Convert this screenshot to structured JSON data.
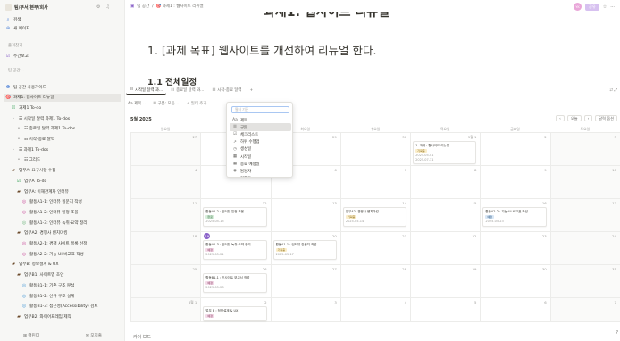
{
  "sidebar": {
    "workspace": "팀/부서/본부/회사",
    "top_items": [
      {
        "icon": "search-icon",
        "glyph": "⌕",
        "label": "검색"
      },
      {
        "icon": "plus-circle-icon",
        "glyph": "⊕",
        "label": "새 페이지"
      }
    ],
    "section_favorites": "즐겨찾기",
    "favorites": [
      {
        "icon": "checkbox-icon",
        "glyph": "☑",
        "label": "주간보고"
      }
    ],
    "section_teamspace": "팀 공간 ⌄",
    "tree": [
      {
        "glyph": "❶",
        "label": "팀 공간 사용가이드",
        "indent": 0,
        "sel": false,
        "color": "#4a7fd6"
      },
      {
        "glyph": "🎯",
        "label": "과제1: 웹사이트 리뉴얼",
        "indent": 0,
        "sel": true,
        "color": "#e0873a"
      },
      {
        "glyph": "☑",
        "label": "과제1 To-do",
        "indent": 1,
        "sel": false,
        "color": "#3aa35a"
      },
      {
        "glyph": "›",
        "label": "☷ 시작일 달력 과제1 To-dos",
        "indent": 1,
        "sel": false,
        "color": "#9b9a97"
      },
      {
        "glyph": "•",
        "label": "☷ 종료일 달력 과제1 To-dos",
        "indent": 2,
        "sel": false,
        "color": "#9b9a97"
      },
      {
        "glyph": "•",
        "label": "☷ 시작-종료 달력",
        "indent": 2,
        "sel": false,
        "color": "#9b9a97"
      },
      {
        "glyph": "›",
        "label": "☷ 과제1 To-dos",
        "indent": 1,
        "sel": false,
        "color": "#9b9a97"
      },
      {
        "glyph": "•",
        "label": "☷ 그리드",
        "indent": 2,
        "sel": false,
        "color": "#9b9a97"
      },
      {
        "glyph": "▰",
        "label": "업무A: 요구사항 수집",
        "indent": 1,
        "sel": false,
        "color": "#6b4a2b"
      },
      {
        "glyph": "☑",
        "label": "업무A To-do",
        "indent": 2,
        "sel": false,
        "color": "#3aa35a"
      },
      {
        "glyph": "▰",
        "label": "업무A: 이해관계자 인터뷰",
        "indent": 2,
        "sel": false,
        "color": "#6b4a2b"
      },
      {
        "glyph": "◎",
        "label": "활동A1-1: 인터뷰 질문지 작성",
        "indent": 3,
        "sel": false,
        "color": "#c94a9a"
      },
      {
        "glyph": "◎",
        "label": "활동A1-2: 인터뷰 일정 조율",
        "indent": 3,
        "sel": false,
        "color": "#c94a9a"
      },
      {
        "glyph": "◎",
        "label": "활동A1-3: 인터뷰 녹취·요약 정리",
        "indent": 3,
        "sel": false,
        "color": "#6bb37a"
      },
      {
        "glyph": "▰",
        "label": "업무A2: 경쟁사 벤치마킹",
        "indent": 2,
        "sel": false,
        "color": "#6b4a2b"
      },
      {
        "glyph": "◎",
        "label": "활동A2-1: 경쟁 사이트 목록 선정",
        "indent": 3,
        "sel": false,
        "color": "#c94a9a"
      },
      {
        "glyph": "◎",
        "label": "활동A2-2: 기능·UI 비교표 작성",
        "indent": 3,
        "sel": false,
        "color": "#c94a9a"
      },
      {
        "glyph": "▰",
        "label": "업무B: 정보설계 & UX",
        "indent": 1,
        "sel": false,
        "color": "#6b4a2b"
      },
      {
        "glyph": "▰",
        "label": "업무B1: 사이트맵 초안",
        "indent": 2,
        "sel": false,
        "color": "#6b4a2b"
      },
      {
        "glyph": "◎",
        "label": "활동B1-1: 기존 구조 분석",
        "indent": 3,
        "sel": false,
        "color": "#4a9ad6"
      },
      {
        "glyph": "◎",
        "label": "활동B1-2: 신규 구조 설계",
        "indent": 3,
        "sel": false,
        "color": "#4a9ad6"
      },
      {
        "glyph": "◎",
        "label": "활동B1-3: 접근성(Accessibility) 검토",
        "indent": 3,
        "sel": false,
        "color": "#4a9ad6"
      },
      {
        "glyph": "▰",
        "label": "업무B2: 와이어프레임 제작",
        "indent": 2,
        "sel": false,
        "color": "#6b4a2b"
      }
    ],
    "footer": [
      "⊞ 캘린더",
      "✉ 모지출"
    ]
  },
  "topbar": {
    "breadcrumb": [
      "팀 공간",
      "/",
      "🎯 과제1 : 웹사이트 리뉴얼"
    ],
    "avatar": "YK",
    "share": "공유",
    "star": "☆",
    "more": "···"
  },
  "page": {
    "bg_title": "과제1: 웹사이트 리뉴얼",
    "h1": "1. [과제 목표] 웹사이트를 개선하여 리뉴얼 한다.",
    "h2": "1.1 전체일정"
  },
  "tabs": [
    {
      "icon": "☷",
      "label": "시작일 달력 과..."
    },
    {
      "icon": "☷",
      "label": "종료일 달력 과..."
    },
    {
      "icon": "☷",
      "label": "시작-종료 달력"
    },
    {
      "icon": "+",
      "label": ""
    }
  ],
  "tabs_right": "⇄ ⤢",
  "filters": [
    {
      "label": "Aa 제목 ⌄",
      "add": false
    },
    {
      "label": "☰ 구분: 모든 ⌄",
      "add": false
    },
    {
      "label": "+ 필터 추가",
      "add": true
    }
  ],
  "dropdown": {
    "placeholder": "필터 기준",
    "items": [
      {
        "icon": "Aa",
        "label": "제목",
        "hl": false
      },
      {
        "icon": "☰",
        "label": "구분",
        "hl": true
      },
      {
        "icon": "☑",
        "label": "체크리스트",
        "hl": false
      },
      {
        "icon": "↗",
        "label": "하위 수행업",
        "hl": false
      },
      {
        "icon": "◷",
        "label": "생성일",
        "hl": false
      },
      {
        "icon": "▦",
        "label": "시작일",
        "hl": false
      },
      {
        "icon": "▦",
        "label": "종료 예정일",
        "hl": false
      },
      {
        "icon": "◉",
        "label": "담당자",
        "hl": false
      },
      {
        "icon": "◔",
        "label": "진행도",
        "hl": false
      }
    ]
  },
  "calendar": {
    "month": "5월 2025",
    "nav": [
      "‹",
      "오늘",
      "›",
      "달력 옵션"
    ],
    "daynames": [
      "일요일",
      "월요일",
      "화요일",
      "수요일",
      "목요일",
      "금요일",
      "토요일"
    ],
    "weeks": [
      {
        "days": [
          "27",
          "28",
          "29",
          "30",
          "5월 1",
          "2",
          "3"
        ]
      },
      {
        "days": [
          "4",
          "5",
          "6",
          "7",
          "8",
          "9",
          "10"
        ]
      },
      {
        "days": [
          "11",
          "12",
          "13",
          "14",
          "15",
          "16",
          "17"
        ]
      },
      {
        "days": [
          "18",
          "19",
          "20",
          "21",
          "22",
          "23",
          "24"
        ]
      },
      {
        "days": [
          "25",
          "26",
          "27",
          "28",
          "29",
          "30",
          "31"
        ]
      },
      {
        "days": [
          "6월 1",
          "2",
          "3",
          "4",
          "5",
          "6",
          "7"
        ]
      }
    ],
    "today_label": "19",
    "cards": [
      {
        "week": 0,
        "day": 4,
        "row": 0,
        "title": "1. 과제 : 웹사이트 리뉴얼",
        "tag": "기획중",
        "tagc": "y",
        "date": "2025-05-01",
        "date2": "2025-07-31"
      },
      {
        "week": 2,
        "day": 1,
        "row": 0,
        "title": "활동A1-2 : 인터뷰 일정 조율",
        "tag": "완료",
        "tagc": "g",
        "date": "2025-05-13",
        "date2": ""
      },
      {
        "week": 2,
        "day": 3,
        "row": 0,
        "title": "업무A2: 경쟁사 벤치마킹",
        "tag": "기획중",
        "tagc": "y",
        "date": "2025-05-14",
        "date2": ""
      },
      {
        "week": 2,
        "day": 5,
        "row": 0,
        "title": "활동A2-2 : 기능·UI 비교표 작성",
        "tag": "예정",
        "tagc": "b",
        "date": "2025-05-23",
        "date2": ""
      },
      {
        "week": 3,
        "day": 1,
        "row": 0,
        "title": "활동A1-3 : 인터뷰 녹취·요약 정리",
        "tag": "예정",
        "tagc": "p",
        "date": "2025-05-21",
        "date2": ""
      },
      {
        "week": 3,
        "day": 2,
        "row": 0,
        "title": "활동A1-1 : 인터뷰 질문지 작성",
        "tag": "기획중",
        "tagc": "y",
        "date": "2025-05-17",
        "date2": ""
      },
      {
        "week": 4,
        "day": 1,
        "row": 0,
        "title": "활동B1-1 : 인사이트 보고서 작성",
        "tag": "예정",
        "tagc": "p",
        "date": "2025-05-28",
        "date2": ""
      },
      {
        "week": 5,
        "day": 1,
        "row": 0,
        "title": "업무 B : 정보설계 & UX",
        "tag": "예정",
        "tagc": "p",
        "date": "",
        "date2": ""
      }
    ]
  },
  "bottom_text": "카이 보드",
  "help": "?"
}
